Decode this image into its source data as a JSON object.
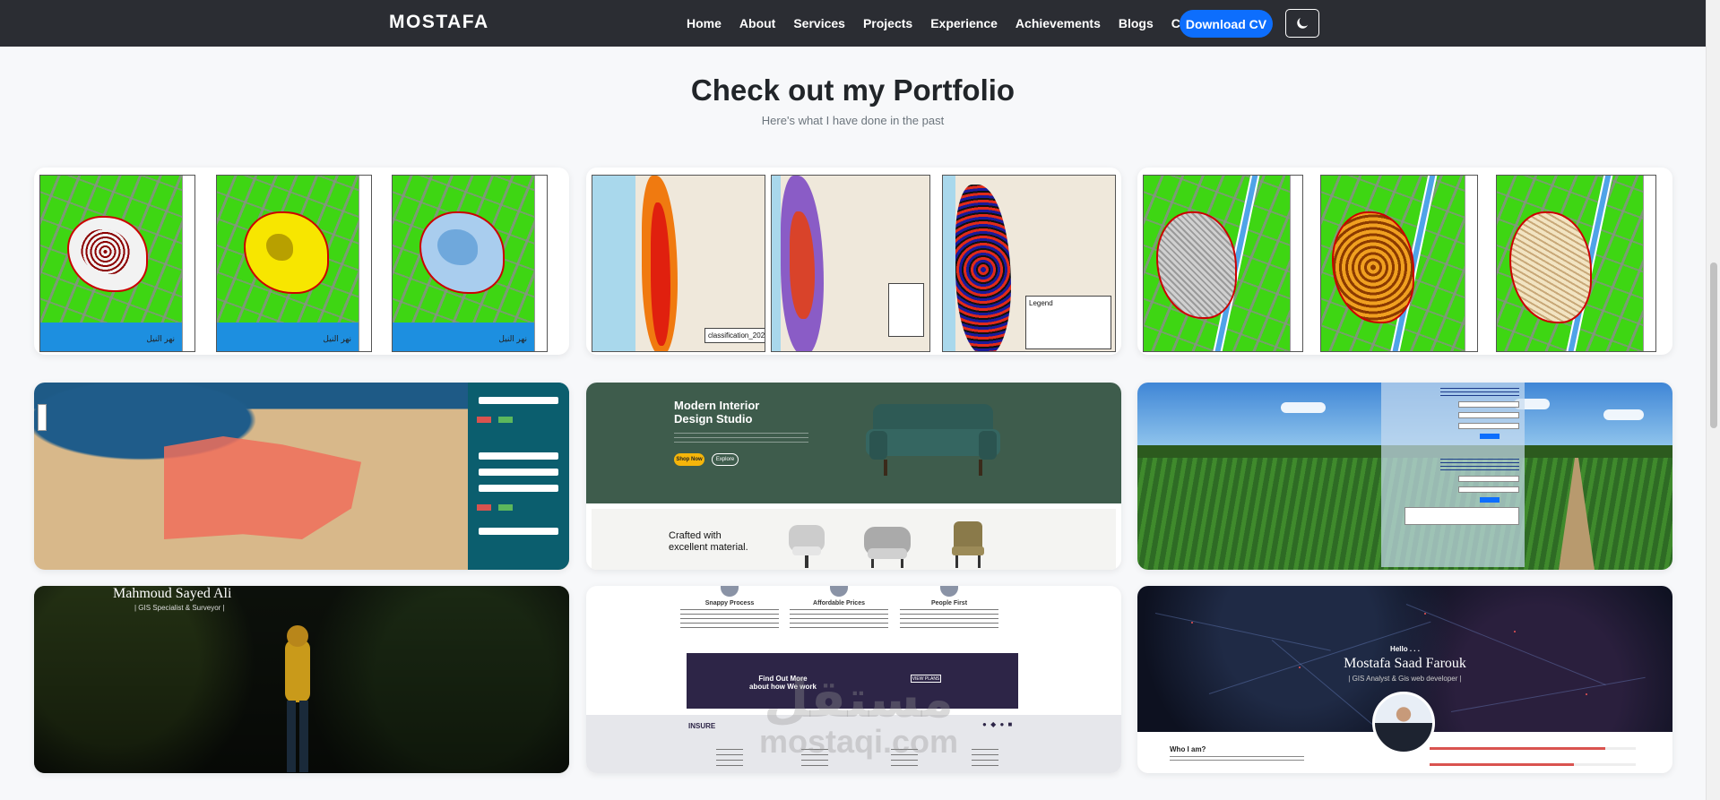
{
  "navbar": {
    "brand": "MOSTAFA",
    "links": [
      "Home",
      "About",
      "Services",
      "Projects",
      "Experience",
      "Achievements",
      "Blogs",
      "Contact"
    ],
    "download_label": "Download CV",
    "theme_icon": "moon-icon"
  },
  "portfolio": {
    "title": "Check out my Portfolio",
    "subtitle": "Here's what I have done in the past"
  },
  "cards": {
    "gis_maps_1": {
      "labels": [
        "نهر النيل",
        "نهر النيل",
        "نهر النيل"
      ]
    },
    "gis_maps_2": {
      "legend_title": "Legend",
      "legend_label": "classification_2020"
    },
    "interior": {
      "hero_title": "Modern Interior\nDesign Studio",
      "shop_label": "Shop Now",
      "explore_label": "Explore",
      "crafted_title": "Crafted with\nexcellent material."
    },
    "portfolio_person": {
      "name": "Mahmoud Sayed Ali",
      "role": "| GIS Specialist & Surveyor |"
    },
    "insure": {
      "features": [
        "Snappy Process",
        "Affordable Prices",
        "People First"
      ],
      "banner_text": "Find Out More\nabout how We work",
      "banner_button": "VIEW PLANS",
      "brand": "INSURE",
      "social_icons": "facebook-icon twitter-icon pinterest-icon instagram-icon"
    },
    "network": {
      "greeting": "Hello . . .",
      "name": "Mostafa Saad Farouk",
      "role": "| GIS Analyst & Gis web developer |",
      "about_heading": "Who I am?"
    }
  },
  "watermark": {
    "arabic": "مستقل",
    "latin": "mostaqi.com"
  },
  "colors": {
    "navbar_bg": "#2b2d33",
    "accent": "#0d6efd",
    "page_bg": "#f7f8fa"
  }
}
